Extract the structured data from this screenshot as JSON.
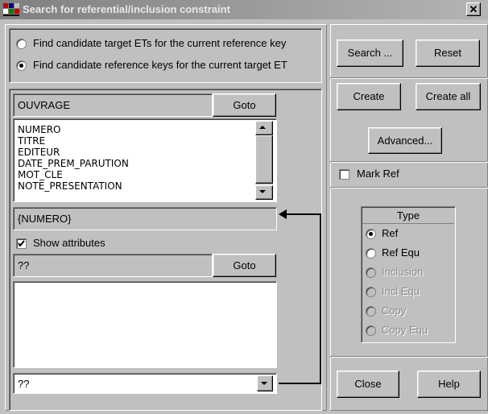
{
  "window": {
    "title": "Search for referential/inclusion constraint",
    "close_glyph": "✕"
  },
  "mode": {
    "options": [
      "Find candidate target ETs for the current reference key",
      "Find candidate reference keys for the current target ET"
    ],
    "selected_index": 1
  },
  "target_et": {
    "name": "OUVRAGE",
    "goto_label": "Goto",
    "attributes": [
      "NUMERO",
      "TITRE",
      "EDITEUR",
      "DATE_PREM_PARUTION",
      "MOT_CLE",
      "NOTE_PRESENTATION"
    ],
    "key": "{NUMERO}"
  },
  "show_attributes": {
    "label": "Show attributes",
    "checked": true
  },
  "reference_et": {
    "name": "??",
    "goto_label": "Goto",
    "attributes": [],
    "key": "??"
  },
  "buttons": {
    "search": "Search ...",
    "reset": "Reset",
    "create": "Create",
    "create_all": "Create all",
    "advanced": "Advanced...",
    "close": "Close",
    "help": "Help"
  },
  "mark_ref": {
    "label": "Mark Ref",
    "checked": false
  },
  "type": {
    "label": "Type",
    "options": [
      {
        "label": "Ref",
        "enabled": true
      },
      {
        "label": "Ref Equ",
        "enabled": true
      },
      {
        "label": "Inclusion",
        "enabled": false
      },
      {
        "label": "Incl Equ",
        "enabled": false
      },
      {
        "label": "Copy",
        "enabled": false
      },
      {
        "label": "Copy Equ",
        "enabled": false
      }
    ],
    "selected_index": 0
  },
  "icons": {
    "app": "app-icon",
    "close": "close-icon",
    "scroll_up": "scroll-up-icon",
    "scroll_down": "scroll-down-icon",
    "dropdown": "chevron-down-icon",
    "connector": "arrow-left-icon"
  },
  "colors": {
    "face": "#c0c0c0",
    "titlebar": "#808080"
  }
}
